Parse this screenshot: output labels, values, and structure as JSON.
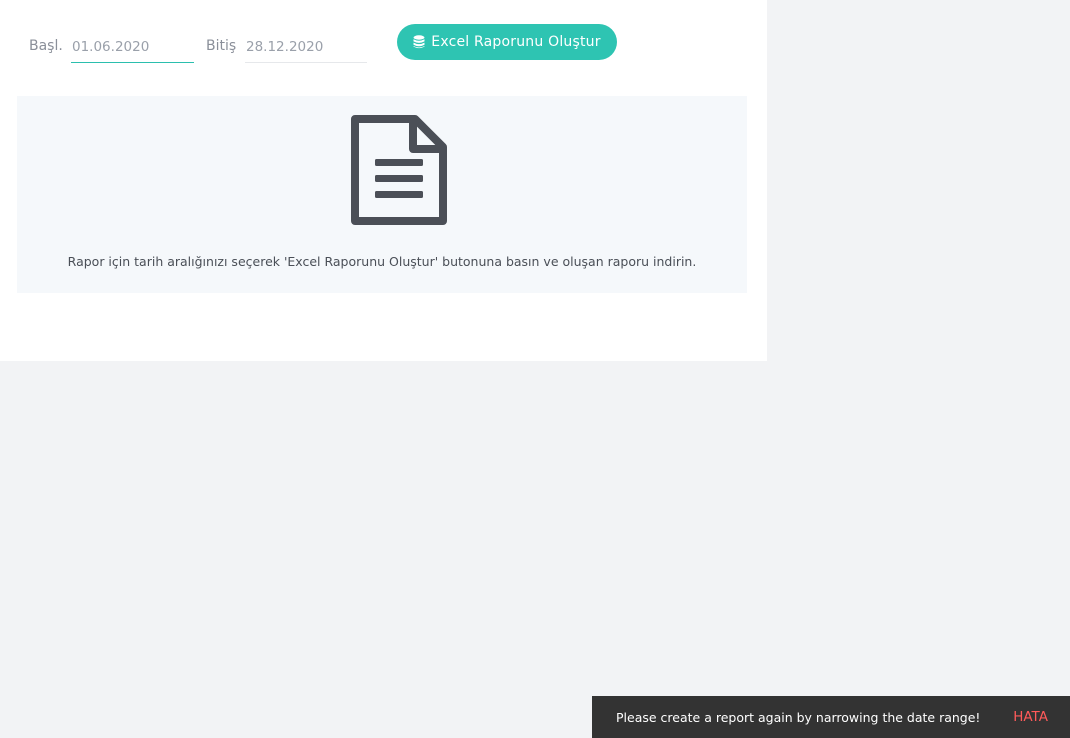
{
  "form": {
    "start_label": "Başl.",
    "start_value": "01.06.2020",
    "end_label": "Bitiş",
    "end_value": "28.12.2020",
    "button_label": "Excel Raporunu Oluştur",
    "button_icon": "database-icon"
  },
  "info": {
    "icon": "document-icon",
    "message": "Rapor için tarih aralığınızı seçerek 'Excel Raporunu Oluştur' butonuna basın ve oluşan raporu indirin."
  },
  "toast": {
    "message": "Please create a report again by narrowing the date range!",
    "action": "HATA"
  },
  "colors": {
    "accent": "#2ec4b2",
    "toast_bg": "#333333",
    "error": "#ff5a5a"
  }
}
